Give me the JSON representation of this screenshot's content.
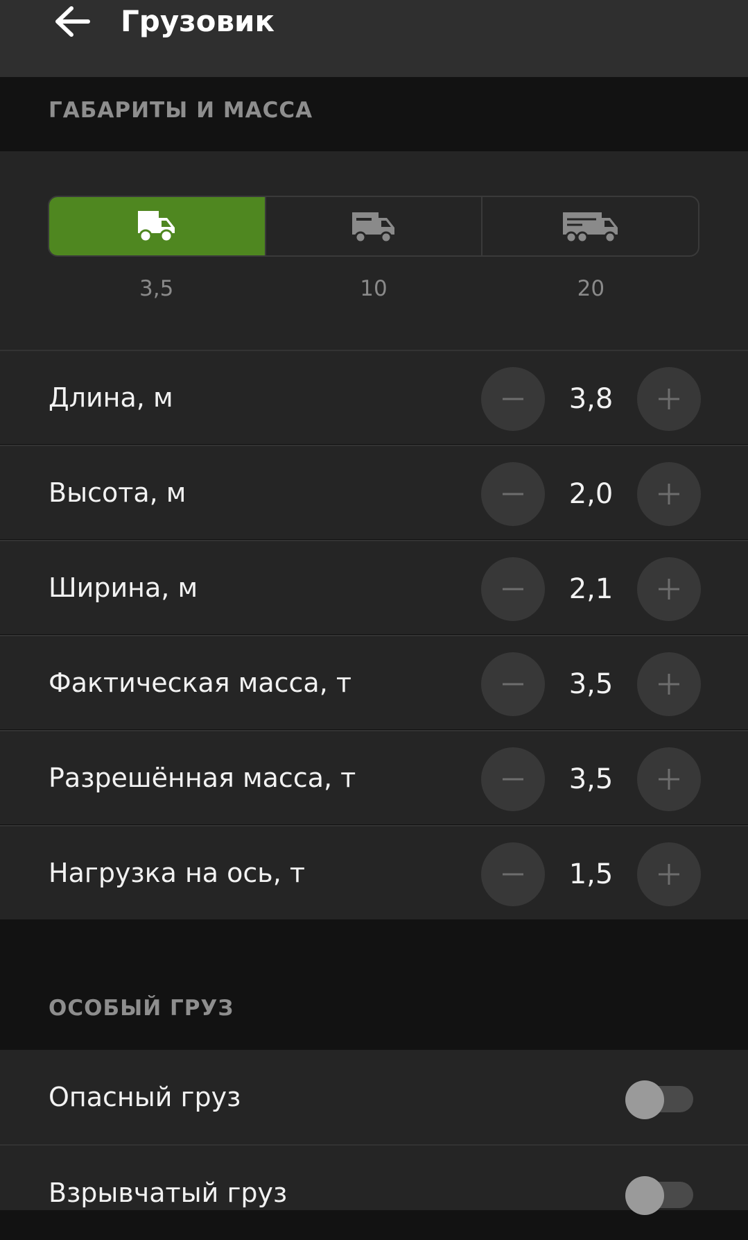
{
  "header": {
    "title": "Грузовик",
    "back_icon": "arrow-left-icon"
  },
  "sections": {
    "dimensions": "ГАБАРИТЫ И МАССА",
    "special": "ОСОБЫЙ ГРУЗ"
  },
  "truck_types": [
    {
      "label": "3,5",
      "icon": "small-truck-icon",
      "active": true
    },
    {
      "label": "10",
      "icon": "medium-truck-icon",
      "active": false
    },
    {
      "label": "20",
      "icon": "large-truck-icon",
      "active": false
    }
  ],
  "params": [
    {
      "label": "Длина, м",
      "value": "3,8"
    },
    {
      "label": "Высота, м",
      "value": "2,0"
    },
    {
      "label": "Ширина, м",
      "value": "2,1"
    },
    {
      "label": "Фактическая масса, т",
      "value": "3,5"
    },
    {
      "label": "Разрешённая масса, т",
      "value": "3,5"
    },
    {
      "label": "Нагрузка на ось, т",
      "value": "1,5"
    }
  ],
  "toggles": [
    {
      "label": "Опасный груз",
      "on": false
    },
    {
      "label": "Взрывчатый груз",
      "on": false
    }
  ],
  "colors": {
    "accent": "#4f8720",
    "background": "#121212",
    "panel": "#252525",
    "header": "#2f2f2f"
  }
}
